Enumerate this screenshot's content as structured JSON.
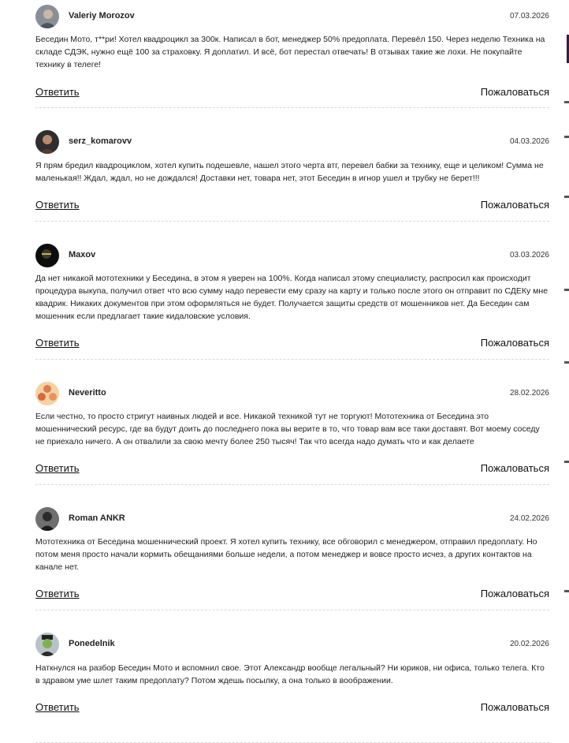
{
  "comments": [
    {
      "author": "Valeriy Morozov",
      "date": "07.03.2026",
      "text": "Беседин Мото, т**ри! Хотел квадроцикл за 300к. Написал в бот, менеджер 50% предоплата. Перевёл 150. Через неделю Техника на складе СДЭК, нужно ещё 100 за страховку. Я доплатил. И всё, бот перестал отвечать! В отзывах такие же лохи. Не покупайте технику в телеге!",
      "reply_label": "Ответить",
      "report_label": "Пожаловаться"
    },
    {
      "author": "serz_komarovv",
      "date": "04.03.2026",
      "text": "Я прям бредил квадроциклом, хотел купить подешевле, нашел этого черта втг, перевел бабки за технику, еще и целиком! Сумма не маленькая!! Ждал, ждал, но не дождался! Доставки нет, товара нет, этот Беседин в игнор ушел и трубку не берет!!!",
      "reply_label": "Ответить",
      "report_label": "Пожаловаться"
    },
    {
      "author": "Maxov",
      "date": "03.03.2026",
      "text": "Да нет никакой мототехники у Беседина, в этом я уверен на 100%. Когда написал этому специалисту, распросил как происходит процедура выкупа, получил ответ что всю сумму надо перевести ему сразу на карту и только после этого он отправит по СДЕКу мне квадрик. Никаких документов при этом оформляться не будет. Получается защиты средств от мошенников нет. Да Беседин сам мошенник если предлагает такие кидаловские условия.",
      "reply_label": "Ответить",
      "report_label": "Пожаловаться"
    },
    {
      "author": "Neveritto",
      "date": "28.02.2026",
      "text": "Если честно, то просто стригут наивных людей и все. Никакой техникой тут не торгуют! Мототехника от Беседина это мошеннический ресурс, где ва будут доить до последнего пока вы верите в то, что товар вам все таки доставят. Вот моему соседу не приехало ничего. А он отвалили за свою мечту более 250 тысяч! Так что всегда надо думать что и как делаете",
      "reply_label": "Ответить",
      "report_label": "Пожаловаться"
    },
    {
      "author": "Roman ANKR",
      "date": "24.02.2026",
      "text": "Мототехника от Беседина мошеннический проект. Я хотел купить технику, все обговорил с менеджером, отправил предоплату. Но потом меня просто начали кормить обещаниями больше недели, а потом менеджер и вовсе просто исчез, а других контактов на канале нет.",
      "reply_label": "Ответить",
      "report_label": "Пожаловаться"
    },
    {
      "author": "Ponedelnik",
      "date": "20.02.2026",
      "text": "Наткнулся на разбор Беседин Мото и вспомнил свое. Этот Александр вообще легальный? Ни юриков, ни офиса, только телега. Кто в здравом уме шлет таким предоплату? Потом ждешь посылку, а она только в воображении.",
      "reply_label": "Ответить",
      "report_label": "Пожаловаться"
    }
  ]
}
